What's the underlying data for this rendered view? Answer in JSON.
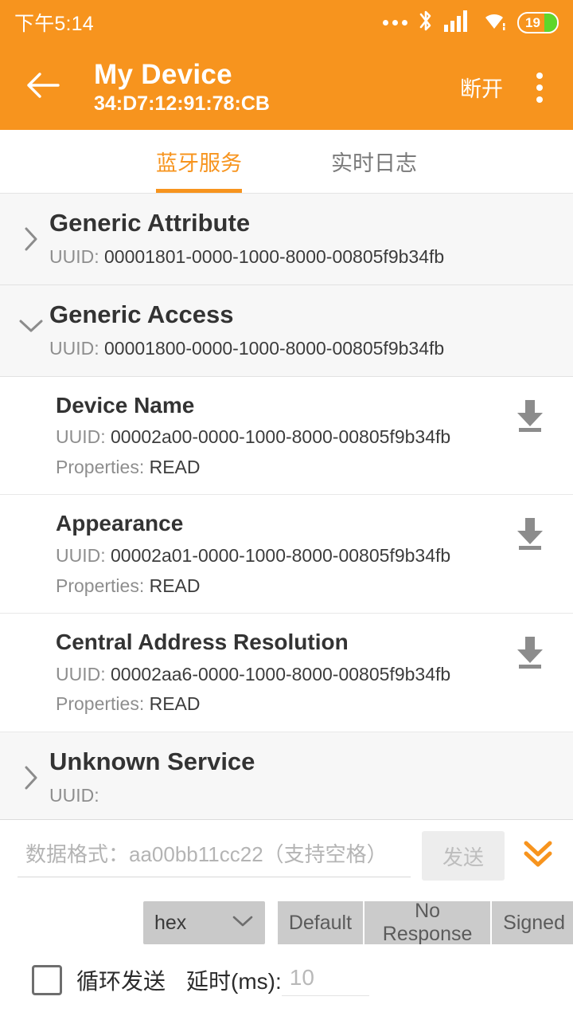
{
  "status_bar": {
    "time": "下午5:14",
    "icons": [
      "more-dots-icon",
      "bluetooth-icon",
      "signal-icon",
      "wifi-icon"
    ],
    "battery_level": "19"
  },
  "app_bar": {
    "back_icon": "back-arrow-icon",
    "title": "My Device",
    "subtitle": "34:D7:12:91:78:CB",
    "disconnect_label": "断开",
    "overflow_icon": "kebab-menu-icon",
    "background_color": "#F7941E"
  },
  "tabs": {
    "items": [
      {
        "label": "蓝牙服务",
        "active": true
      },
      {
        "label": "实时日志",
        "active": false
      }
    ],
    "accent_color": "#F7941E"
  },
  "services": [
    {
      "name": "Generic Attribute",
      "uuid_label": "UUID: ",
      "uuid": "00001801-0000-1000-8000-00805f9b34fb",
      "expanded": false,
      "chevron": "chevron-right-icon",
      "characteristics": []
    },
    {
      "name": "Generic Access",
      "uuid_label": "UUID: ",
      "uuid": "00001800-0000-1000-8000-00805f9b34fb",
      "expanded": true,
      "chevron": "chevron-down-icon",
      "characteristics": [
        {
          "name": "Device Name",
          "uuid_label": "UUID: ",
          "uuid": "00002a00-0000-1000-8000-00805f9b34fb",
          "props_label": "Properties: ",
          "props": "READ",
          "action_icon": "download-read-icon"
        },
        {
          "name": "Appearance",
          "uuid_label": "UUID: ",
          "uuid": "00002a01-0000-1000-8000-00805f9b34fb",
          "props_label": "Properties: ",
          "props": "READ",
          "action_icon": "download-read-icon"
        },
        {
          "name": "Central Address Resolution",
          "uuid_label": "UUID: ",
          "uuid": "00002aa6-0000-1000-8000-00805f9b34fb",
          "props_label": "Properties: ",
          "props": "READ",
          "action_icon": "download-read-icon"
        }
      ]
    },
    {
      "name": "Unknown Service",
      "uuid_label": "UUID: ",
      "uuid": "",
      "expanded": false,
      "chevron": "chevron-right-icon",
      "characteristics": []
    }
  ],
  "bottom_panel": {
    "data_input": {
      "value": "",
      "placeholder": "数据格式：aa00bb11cc22（支持空格）"
    },
    "send_button": {
      "label": "发送",
      "disabled": true
    },
    "expand_icon": "double-chevron-down-icon",
    "format_select": {
      "value": "hex",
      "chevron": "chevron-down-icon"
    },
    "write_type_buttons": [
      "Default",
      "No Response",
      "Signed"
    ],
    "loop_checkbox": {
      "label": "循环发送",
      "checked": false
    },
    "delay": {
      "label": "延时(ms):",
      "value": "",
      "placeholder": "10"
    }
  }
}
